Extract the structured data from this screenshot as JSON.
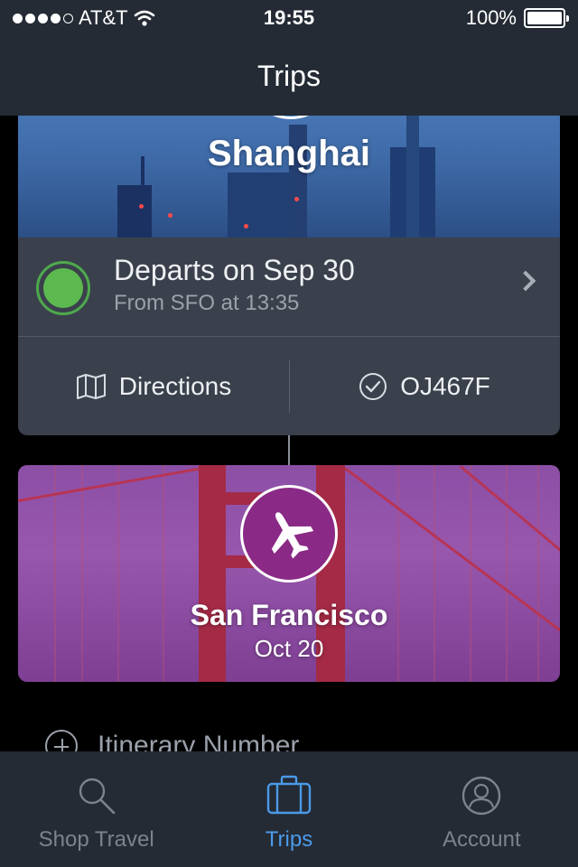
{
  "status_bar": {
    "carrier": "AT&T",
    "time": "19:55",
    "battery": "100%",
    "battery_level": 1.0
  },
  "nav": {
    "title": "Trips"
  },
  "trips": [
    {
      "city": "Shanghai",
      "depart_title": "Departs on Sep 30",
      "depart_subtitle": "From SFO at 13:35",
      "actions": {
        "directions": "Directions",
        "confirmation": "OJ467F"
      }
    },
    {
      "city": "San Francisco",
      "date": "Oct 20"
    }
  ],
  "itinerary": {
    "label": "Itinerary Number"
  },
  "tabs": [
    {
      "label": "Shop Travel",
      "icon": "search-icon"
    },
    {
      "label": "Trips",
      "icon": "suitcase-icon",
      "active": true
    },
    {
      "label": "Account",
      "icon": "user-icon"
    }
  ],
  "colors": {
    "bar_background": "#242b35",
    "card_background": "#3a414c",
    "active_tab": "#4b9ae8",
    "status_green": "#5cb94f",
    "sf_purple": "#8a2a86"
  }
}
